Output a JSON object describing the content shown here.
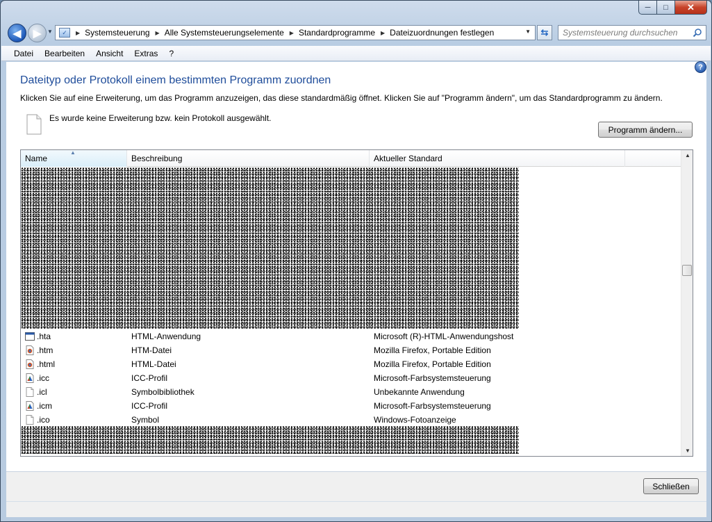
{
  "window": {
    "caption_buttons": {
      "minimize": "─",
      "maximize": "□",
      "close": "✕"
    }
  },
  "nav": {
    "back_glyph": "◀",
    "forward_glyph": "▶",
    "breadcrumbs": [
      "Systemsteuerung",
      "Alle Systemsteuerungselemente",
      "Standardprogramme",
      "Dateizuordnungen festlegen"
    ],
    "search_placeholder": "Systemsteuerung durchsuchen"
  },
  "menu": [
    "Datei",
    "Bearbeiten",
    "Ansicht",
    "Extras",
    "?"
  ],
  "page": {
    "heading": "Dateityp oder Protokoll einem bestimmten Programm zuordnen",
    "description": "Klicken Sie auf eine Erweiterung, um das Programm anzuzeigen, das diese standardmäßig öffnet. Klicken Sie auf \"Programm ändern\", um das Standardprogramm zu ändern.",
    "selection_text": "Es wurde keine Erweiterung bzw. kein Protokoll ausgewählt.",
    "change_button": "Programm ändern...",
    "help_glyph": "?"
  },
  "list": {
    "columns": [
      "Name",
      "Beschreibung",
      "Aktueller Standard"
    ],
    "rows": [
      {
        "name": ".hta",
        "description": "HTML-Anwendung",
        "default": "Microsoft (R)-HTML-Anwendungshost",
        "icon": "hta-icon"
      },
      {
        "name": ".htm",
        "description": "HTM-Datei",
        "default": "Mozilla Firefox, Portable Edition",
        "icon": "firefox-document-icon"
      },
      {
        "name": ".html",
        "description": "HTML-Datei",
        "default": "Mozilla Firefox, Portable Edition",
        "icon": "firefox-document-icon"
      },
      {
        "name": ".icc",
        "description": "ICC-Profil",
        "default": "Microsoft-Farbsystemsteuerung",
        "icon": "color-profile-icon"
      },
      {
        "name": ".icl",
        "description": "Symbolbibliothek",
        "default": "Unbekannte Anwendung",
        "icon": "blank-document-icon"
      },
      {
        "name": ".icm",
        "description": "ICC-Profil",
        "default": "Microsoft-Farbsystemsteuerung",
        "icon": "color-profile-icon"
      },
      {
        "name": ".ico",
        "description": "Symbol",
        "default": "Windows-Fotoanzeige",
        "icon": "blank-document-icon"
      }
    ]
  },
  "footer": {
    "close_button": "Schließen"
  },
  "colors": {
    "heading": "#1e4c9a",
    "window_frame": "#b9cde3",
    "close_button": "#c7432a"
  }
}
